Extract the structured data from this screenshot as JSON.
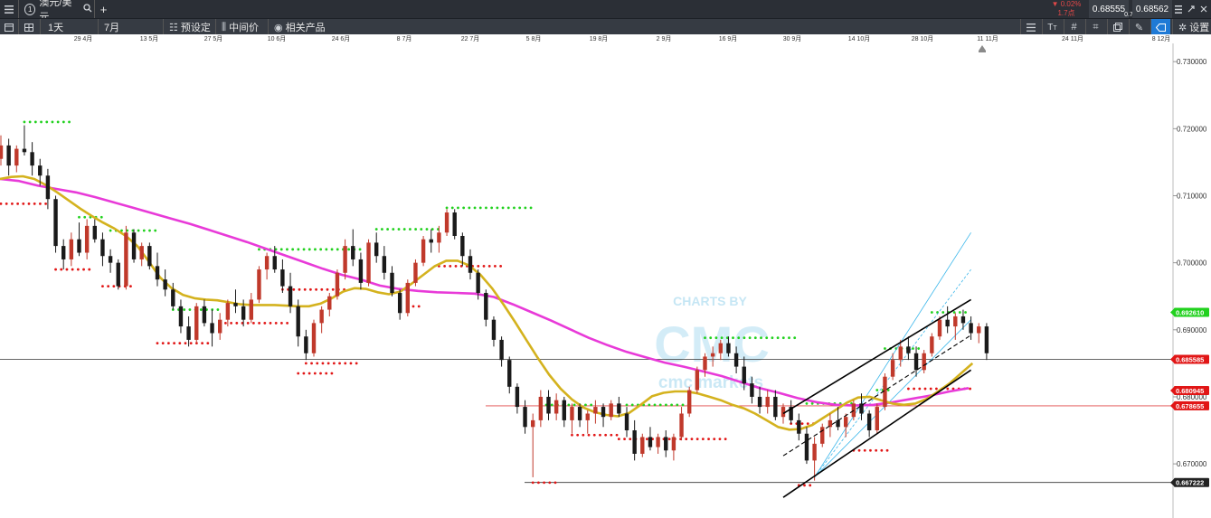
{
  "window": {
    "menu_icon": "hamburger-icon",
    "tab_number": "1",
    "tab_title": "澳元/美元",
    "add_tab": "+"
  },
  "quote": {
    "change_pct": "▼ 0.02%",
    "change_points": "1.7点",
    "bid": "0.68555",
    "spread": "0.7",
    "ask": "0.68562"
  },
  "toolbar": {
    "timeframe": "1天",
    "range": "7月",
    "preset": "预设定",
    "mid_price": "中间价",
    "related": "相关产品",
    "settings": "设置"
  },
  "date_labels": [
    "29 4月",
    "13 5月",
    "27 5月",
    "10 6月",
    "24 6月",
    "8 7月",
    "22 7月",
    "5 8月",
    "19 8月",
    "2 9月",
    "16 9月",
    "30 9月",
    "14 10月",
    "28 10月",
    "11 11月",
    "24 11月",
    "8 12月"
  ],
  "watermark": {
    "line1": "CHARTS BY",
    "line2": "CMC",
    "line3": "cmc markets"
  },
  "colors": {
    "bull": "#c0392b",
    "bear": "#1a1a1a",
    "ma_fast": "#d4b21e",
    "ma_slow": "#e83ad8",
    "pivot_high": "#21d11e",
    "pivot_low": "#e11616",
    "channel": "#000000",
    "fib": "#3ab6ea"
  },
  "chart_data": {
    "type": "candlestick",
    "instrument": "澳元/美元",
    "timeframe": "1天",
    "ylim": [
      0.6645,
      0.7365
    ],
    "y_ticks": [
      "0.730000",
      "0.720000",
      "0.710000",
      "0.700000",
      "0.690000",
      "0.680000",
      "0.670000"
    ],
    "candles": [
      [
        0.7155,
        0.719,
        0.7145,
        0.7175
      ],
      [
        0.7175,
        0.7185,
        0.713,
        0.7145
      ],
      [
        0.7145,
        0.7175,
        0.7135,
        0.717
      ],
      [
        0.717,
        0.7205,
        0.716,
        0.7165
      ],
      [
        0.7165,
        0.718,
        0.713,
        0.7145
      ],
      [
        0.7145,
        0.7155,
        0.7115,
        0.713
      ],
      [
        0.713,
        0.714,
        0.708,
        0.7095
      ],
      [
        0.7095,
        0.71,
        0.7015,
        0.7025
      ],
      [
        0.7025,
        0.7035,
        0.699,
        0.7005
      ],
      [
        0.7005,
        0.7045,
        0.6995,
        0.7035
      ],
      [
        0.7035,
        0.706,
        0.701,
        0.7015
      ],
      [
        0.7015,
        0.7065,
        0.7005,
        0.7055
      ],
      [
        0.7055,
        0.7065,
        0.703,
        0.7035
      ],
      [
        0.7035,
        0.7045,
        0.6995,
        0.701
      ],
      [
        0.701,
        0.702,
        0.6985,
        0.7
      ],
      [
        0.7,
        0.7005,
        0.696,
        0.6965
      ],
      [
        0.6965,
        0.7055,
        0.696,
        0.7045
      ],
      [
        0.7045,
        0.705,
        0.7,
        0.7005
      ],
      [
        0.7005,
        0.703,
        0.6995,
        0.7025
      ],
      [
        0.7025,
        0.703,
        0.699,
        0.6995
      ],
      [
        0.6995,
        0.7015,
        0.6965,
        0.6975
      ],
      [
        0.6975,
        0.699,
        0.695,
        0.696
      ],
      [
        0.696,
        0.697,
        0.693,
        0.6935
      ],
      [
        0.6935,
        0.6945,
        0.6895,
        0.6905
      ],
      [
        0.6905,
        0.692,
        0.6875,
        0.6885
      ],
      [
        0.6885,
        0.694,
        0.688,
        0.6935
      ],
      [
        0.6935,
        0.6945,
        0.6905,
        0.691
      ],
      [
        0.691,
        0.693,
        0.6875,
        0.6895
      ],
      [
        0.6895,
        0.6925,
        0.6885,
        0.6915
      ],
      [
        0.6915,
        0.6945,
        0.6905,
        0.694
      ],
      [
        0.694,
        0.696,
        0.6925,
        0.6935
      ],
      [
        0.6935,
        0.6945,
        0.6905,
        0.6915
      ],
      [
        0.6915,
        0.6955,
        0.691,
        0.6945
      ],
      [
        0.6945,
        0.6995,
        0.694,
        0.699
      ],
      [
        0.699,
        0.7015,
        0.6975,
        0.701
      ],
      [
        0.701,
        0.7025,
        0.6985,
        0.699
      ],
      [
        0.699,
        0.7005,
        0.6955,
        0.6965
      ],
      [
        0.6965,
        0.6985,
        0.6925,
        0.6935
      ],
      [
        0.6935,
        0.6945,
        0.6875,
        0.689
      ],
      [
        0.689,
        0.69,
        0.6855,
        0.6865
      ],
      [
        0.6865,
        0.6915,
        0.686,
        0.691
      ],
      [
        0.691,
        0.6935,
        0.6895,
        0.693
      ],
      [
        0.693,
        0.6955,
        0.692,
        0.695
      ],
      [
        0.695,
        0.699,
        0.6945,
        0.6985
      ],
      [
        0.6985,
        0.7035,
        0.6975,
        0.7025
      ],
      [
        0.7025,
        0.705,
        0.6995,
        0.7005
      ],
      [
        0.7005,
        0.7015,
        0.696,
        0.697
      ],
      [
        0.697,
        0.7035,
        0.6965,
        0.703
      ],
      [
        0.703,
        0.7045,
        0.7,
        0.701
      ],
      [
        0.701,
        0.7025,
        0.6975,
        0.6985
      ],
      [
        0.6985,
        0.6995,
        0.695,
        0.6955
      ],
      [
        0.6955,
        0.696,
        0.6915,
        0.6925
      ],
      [
        0.6925,
        0.6975,
        0.692,
        0.697
      ],
      [
        0.697,
        0.7005,
        0.6965,
        0.7
      ],
      [
        0.7,
        0.704,
        0.6995,
        0.7035
      ],
      [
        0.7035,
        0.705,
        0.7015,
        0.703
      ],
      [
        0.703,
        0.7055,
        0.7015,
        0.7045
      ],
      [
        0.7045,
        0.708,
        0.704,
        0.7075
      ],
      [
        0.7075,
        0.708,
        0.7035,
        0.704
      ],
      [
        0.704,
        0.7045,
        0.6995,
        0.701
      ],
      [
        0.701,
        0.702,
        0.6975,
        0.6985
      ],
      [
        0.6985,
        0.699,
        0.6945,
        0.6955
      ],
      [
        0.6955,
        0.696,
        0.6905,
        0.6915
      ],
      [
        0.6915,
        0.692,
        0.6875,
        0.6885
      ],
      [
        0.6885,
        0.689,
        0.6845,
        0.6855
      ],
      [
        0.6855,
        0.686,
        0.6805,
        0.6815
      ],
      [
        0.6815,
        0.682,
        0.6775,
        0.6785
      ],
      [
        0.6785,
        0.6795,
        0.6745,
        0.6755
      ],
      [
        0.6755,
        0.6775,
        0.668,
        0.6765
      ],
      [
        0.6765,
        0.681,
        0.6755,
        0.68
      ],
      [
        0.68,
        0.681,
        0.6765,
        0.6775
      ],
      [
        0.6775,
        0.6805,
        0.6765,
        0.6795
      ],
      [
        0.6795,
        0.68,
        0.6755,
        0.6765
      ],
      [
        0.6765,
        0.679,
        0.6745,
        0.6785
      ],
      [
        0.6785,
        0.679,
        0.6755,
        0.6765
      ],
      [
        0.6765,
        0.678,
        0.6745,
        0.6775
      ],
      [
        0.6775,
        0.6795,
        0.676,
        0.6785
      ],
      [
        0.6785,
        0.679,
        0.6755,
        0.677
      ],
      [
        0.677,
        0.6795,
        0.6765,
        0.679
      ],
      [
        0.679,
        0.68,
        0.677,
        0.6775
      ],
      [
        0.6775,
        0.6785,
        0.674,
        0.675
      ],
      [
        0.675,
        0.6765,
        0.6705,
        0.6715
      ],
      [
        0.6715,
        0.6745,
        0.671,
        0.674
      ],
      [
        0.674,
        0.6755,
        0.672,
        0.6725
      ],
      [
        0.6725,
        0.6745,
        0.6715,
        0.674
      ],
      [
        0.674,
        0.675,
        0.671,
        0.672
      ],
      [
        0.672,
        0.6745,
        0.6705,
        0.674
      ],
      [
        0.674,
        0.6785,
        0.6735,
        0.6775
      ],
      [
        0.6775,
        0.6815,
        0.677,
        0.681
      ],
      [
        0.681,
        0.6845,
        0.6805,
        0.684
      ],
      [
        0.684,
        0.6865,
        0.683,
        0.686
      ],
      [
        0.686,
        0.6875,
        0.6845,
        0.6865
      ],
      [
        0.6865,
        0.6885,
        0.6855,
        0.688
      ],
      [
        0.688,
        0.689,
        0.686,
        0.6865
      ],
      [
        0.6865,
        0.6875,
        0.6835,
        0.6845
      ],
      [
        0.6845,
        0.686,
        0.681,
        0.682
      ],
      [
        0.682,
        0.683,
        0.679,
        0.68
      ],
      [
        0.68,
        0.6815,
        0.6775,
        0.6785
      ],
      [
        0.6785,
        0.681,
        0.6775,
        0.68
      ],
      [
        0.68,
        0.681,
        0.6765,
        0.677
      ],
      [
        0.677,
        0.679,
        0.676,
        0.6785
      ],
      [
        0.6785,
        0.6795,
        0.676,
        0.6765
      ],
      [
        0.6765,
        0.6775,
        0.6735,
        0.6745
      ],
      [
        0.6745,
        0.6755,
        0.67,
        0.6705
      ],
      [
        0.6705,
        0.674,
        0.6675,
        0.673
      ],
      [
        0.673,
        0.676,
        0.6725,
        0.6755
      ],
      [
        0.6755,
        0.6775,
        0.674,
        0.6765
      ],
      [
        0.6765,
        0.6785,
        0.675,
        0.6755
      ],
      [
        0.6755,
        0.6775,
        0.674,
        0.677
      ],
      [
        0.677,
        0.6795,
        0.6765,
        0.679
      ],
      [
        0.679,
        0.6805,
        0.6765,
        0.6775
      ],
      [
        0.6775,
        0.678,
        0.674,
        0.675
      ],
      [
        0.675,
        0.679,
        0.6745,
        0.6785
      ],
      [
        0.6785,
        0.6835,
        0.678,
        0.683
      ],
      [
        0.683,
        0.6865,
        0.6825,
        0.6855
      ],
      [
        0.6855,
        0.6885,
        0.6845,
        0.6875
      ],
      [
        0.6875,
        0.689,
        0.6855,
        0.6865
      ],
      [
        0.6865,
        0.6875,
        0.683,
        0.684
      ],
      [
        0.684,
        0.687,
        0.6835,
        0.6865
      ],
      [
        0.6865,
        0.6895,
        0.686,
        0.689
      ],
      [
        0.689,
        0.692,
        0.6885,
        0.6915
      ],
      [
        0.6915,
        0.6935,
        0.6895,
        0.6905
      ],
      [
        0.6905,
        0.6925,
        0.6885,
        0.692
      ],
      [
        0.692,
        0.693,
        0.69,
        0.691
      ],
      [
        0.691,
        0.692,
        0.6885,
        0.6895
      ],
      [
        0.6895,
        0.691,
        0.688,
        0.6905
      ],
      [
        0.6905,
        0.691,
        0.6855,
        0.6865
      ]
    ],
    "ma_fast": [
      0.7125,
      0.7128,
      0.7129,
      0.7125,
      0.7116,
      0.7105,
      0.7093,
      0.7081,
      0.707,
      0.706,
      0.7051,
      0.704,
      0.7025,
      0.7002,
      0.6978,
      0.6962,
      0.6952,
      0.6947,
      0.6945,
      0.6944,
      0.6941,
      0.6938,
      0.6937,
      0.6937,
      0.6937,
      0.6936,
      0.6935,
      0.6935,
      0.6939,
      0.6947,
      0.6957,
      0.6962,
      0.6961,
      0.6956,
      0.6953,
      0.6957,
      0.6969,
      0.6982,
      0.6995,
      0.7003,
      0.7003,
      0.6996,
      0.6982,
      0.6962,
      0.6938,
      0.6912,
      0.6885,
      0.6858,
      0.6833,
      0.6812,
      0.6796,
      0.6784,
      0.6777,
      0.6773,
      0.6771,
      0.6776,
      0.6788,
      0.6801,
      0.6806,
      0.6808,
      0.6808,
      0.6805,
      0.68,
      0.6795,
      0.6788,
      0.6783,
      0.6775,
      0.6765,
      0.6755,
      0.6751,
      0.6752,
      0.6758,
      0.6769,
      0.678,
      0.6791,
      0.6799,
      0.68,
      0.6795,
      0.679,
      0.6788,
      0.679,
      0.6797,
      0.6808,
      0.682,
      0.6835,
      0.685
    ],
    "ma_slow": [
      0.7125,
      0.7122,
      0.7115,
      0.711,
      0.7105,
      0.7098,
      0.709,
      0.7082,
      0.7074,
      0.7066,
      0.7058,
      0.7049,
      0.704,
      0.7031,
      0.7021,
      0.7011,
      0.7001,
      0.6991,
      0.6982,
      0.6975,
      0.6966,
      0.6961,
      0.6958,
      0.6956,
      0.6955,
      0.6954,
      0.6949,
      0.6938,
      0.6926,
      0.6914,
      0.6901,
      0.6888,
      0.6877,
      0.6867,
      0.6859,
      0.6851,
      0.6845,
      0.6838,
      0.6831,
      0.6822,
      0.6813,
      0.6806,
      0.6798,
      0.6792,
      0.6788,
      0.6787,
      0.6788,
      0.6792,
      0.6797,
      0.6802,
      0.6808,
      0.6813
    ],
    "annotations": [
      {
        "label": "0.692610",
        "price": 0.69261,
        "color": "#21d11e"
      },
      {
        "label": "0.685585",
        "price": 0.685585,
        "color": "#e11616"
      },
      {
        "label": "0.680945",
        "price": 0.680945,
        "color": "#e11616"
      },
      {
        "label": "0.678655",
        "price": 0.678655,
        "color": "#e11616"
      },
      {
        "label": "0.667222",
        "price": 0.667222,
        "color": "#222222"
      }
    ]
  }
}
